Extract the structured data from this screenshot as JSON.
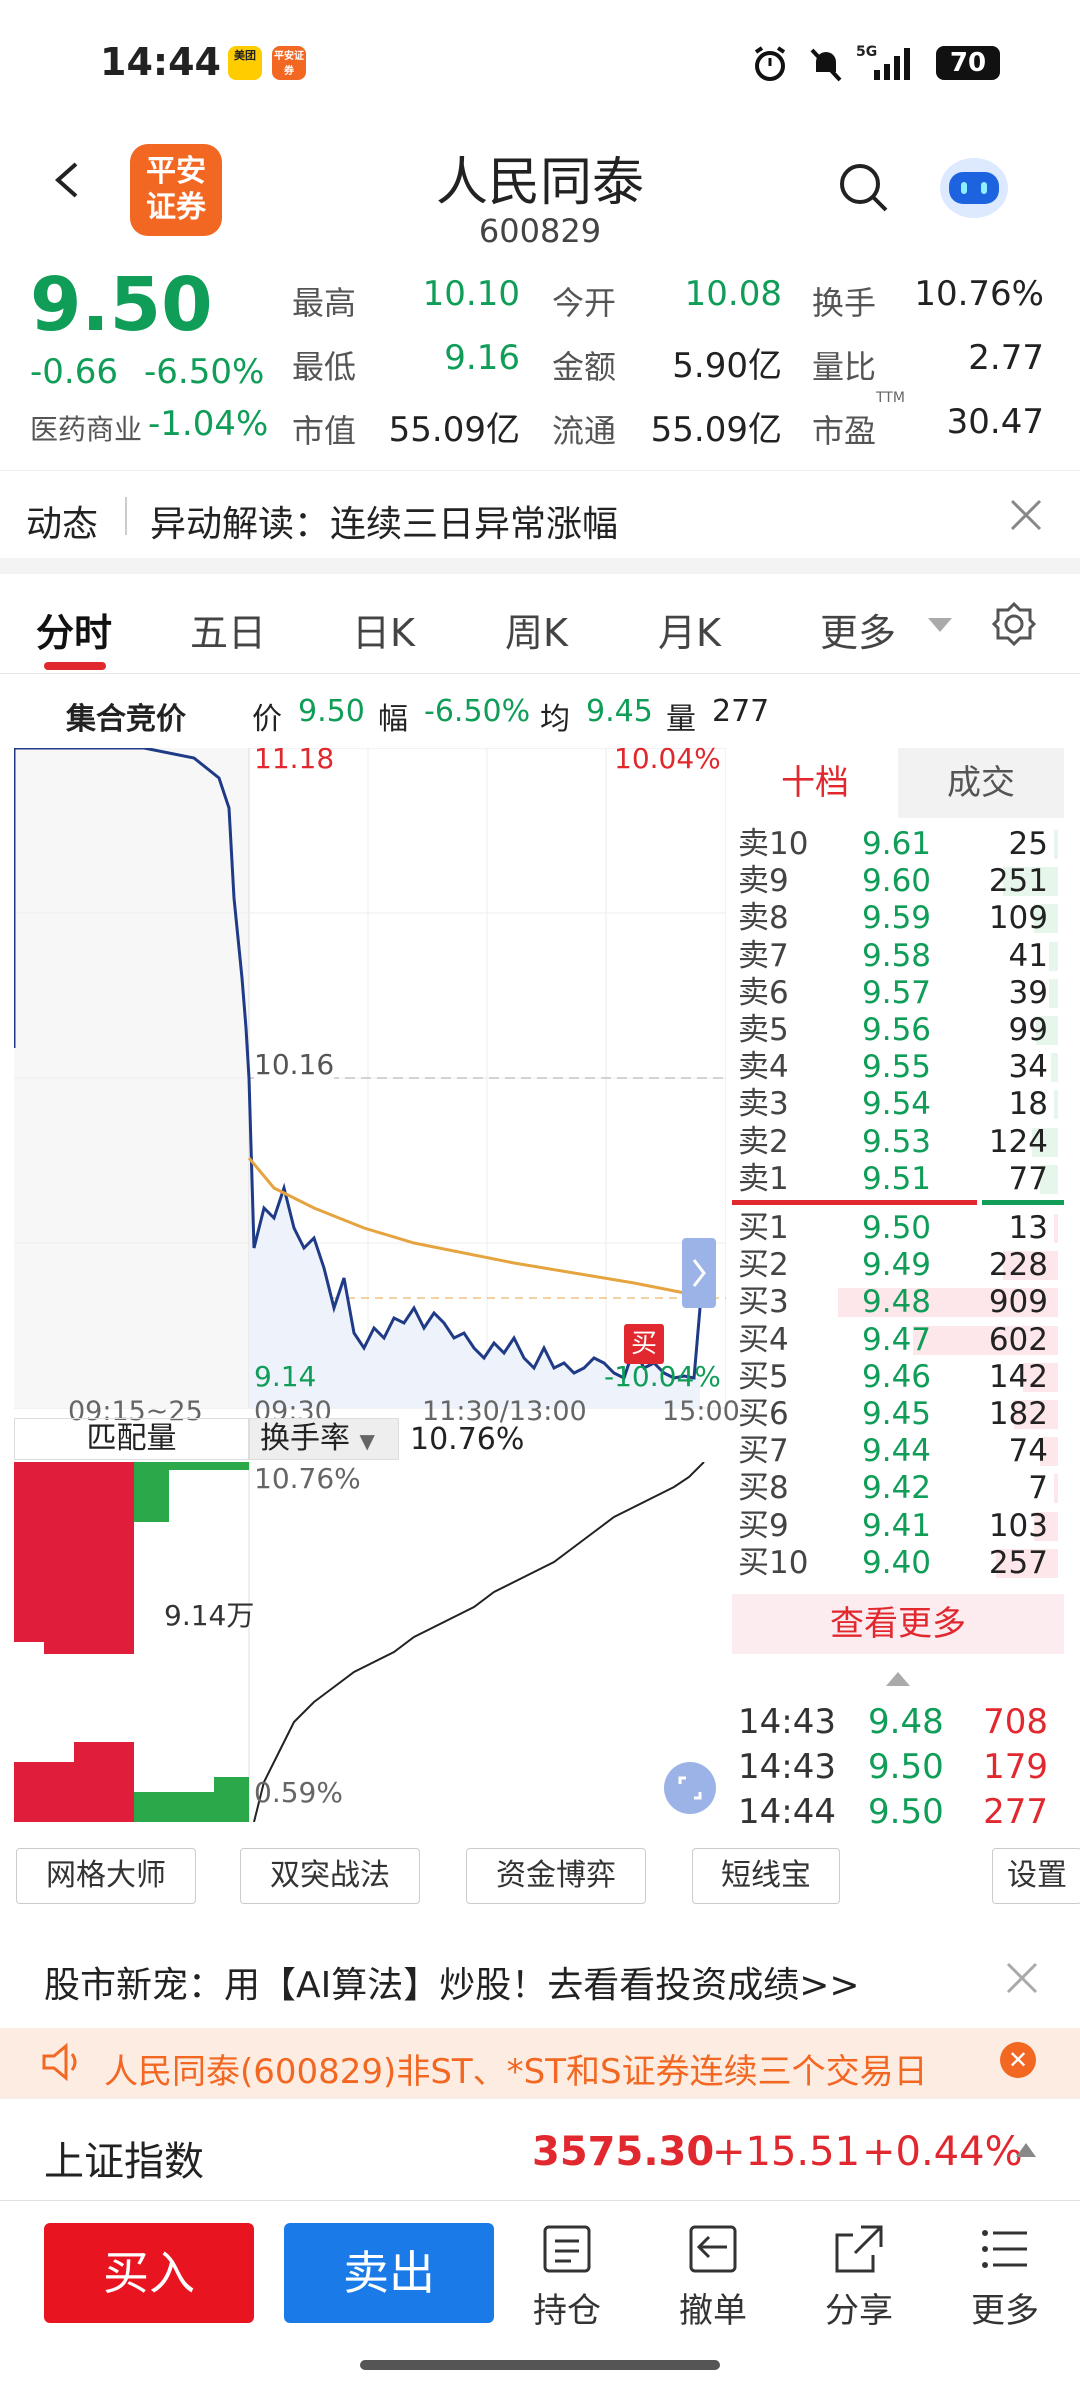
{
  "status_bar": {
    "time": "14:44",
    "app1": "美团",
    "app2": "平安证券",
    "signal": "5G",
    "battery": "70"
  },
  "header": {
    "logo_text": "平安证券",
    "title": "人民同泰",
    "code": "600829"
  },
  "quote": {
    "price": "9.50",
    "change": "-0.66",
    "change_pct": "-6.50%",
    "sector": "医药商业",
    "sector_pct": "-1.04%",
    "fields": [
      {
        "label": "最高",
        "value": "10.10",
        "color": "green"
      },
      {
        "label": "今开",
        "value": "10.08",
        "color": "green"
      },
      {
        "label": "换手",
        "value": "10.76%",
        "color": "black"
      },
      {
        "label": "最低",
        "value": "9.16",
        "color": "green"
      },
      {
        "label": "金额",
        "value": "5.90亿",
        "color": "black"
      },
      {
        "label": "量比",
        "value": "2.77",
        "color": "black"
      },
      {
        "label": "市值",
        "value": "55.09亿",
        "color": "black"
      },
      {
        "label": "流通",
        "value": "55.09亿",
        "color": "black"
      },
      {
        "label": "市盈",
        "value": "30.47",
        "color": "black"
      }
    ],
    "ttm": "TTM"
  },
  "news": {
    "tag": "动态",
    "text": "异动解读：连续三日异常涨幅"
  },
  "tabs": [
    "分时",
    "五日",
    "日K",
    "周K",
    "月K",
    "更多"
  ],
  "infobar": {
    "label": "集合竞价",
    "price_label": "价",
    "price": "9.50",
    "range_label": "幅",
    "range": "-6.50%",
    "avg_label": "均",
    "avg": "9.45",
    "vol_label": "量",
    "vol": "277"
  },
  "chart": {
    "high_price": "11.18",
    "high_pct": "10.04%",
    "mid_price": "10.16",
    "low_price": "9.14",
    "low_pct": "-10.04%",
    "time_labels": [
      "09:15~25",
      "09:30",
      "11:30/13:00",
      "15:00"
    ],
    "buy_marker": "买",
    "sub_tab1": "匹配量",
    "sub_tab2": "换手率",
    "sub_value": "10.76%",
    "sub_top": "10.76%",
    "sub_mid": "9.14万",
    "sub_bottom": "0.59%"
  },
  "orderbook": {
    "tab1": "十档",
    "tab2": "成交",
    "asks": [
      {
        "label": "卖10",
        "price": "9.61",
        "vol": "25",
        "bar": 0.02
      },
      {
        "label": "卖9",
        "price": "9.60",
        "vol": "251",
        "bar": 0.25
      },
      {
        "label": "卖8",
        "price": "9.59",
        "vol": "109",
        "bar": 0.11
      },
      {
        "label": "卖7",
        "price": "9.58",
        "vol": "41",
        "bar": 0.04
      },
      {
        "label": "卖6",
        "price": "9.57",
        "vol": "39",
        "bar": 0.04
      },
      {
        "label": "卖5",
        "price": "9.56",
        "vol": "99",
        "bar": 0.1
      },
      {
        "label": "卖4",
        "price": "9.55",
        "vol": "34",
        "bar": 0.03
      },
      {
        "label": "卖3",
        "price": "9.54",
        "vol": "18",
        "bar": 0.02
      },
      {
        "label": "卖2",
        "price": "9.53",
        "vol": "124",
        "bar": 0.12
      },
      {
        "label": "卖1",
        "price": "9.51",
        "vol": "77",
        "bar": 0.08
      }
    ],
    "bids": [
      {
        "label": "买1",
        "price": "9.50",
        "vol": "13",
        "bar": 0.01
      },
      {
        "label": "买2",
        "price": "9.49",
        "vol": "228",
        "bar": 0.25
      },
      {
        "label": "买3",
        "price": "9.48",
        "vol": "909",
        "bar": 1.0
      },
      {
        "label": "买4",
        "price": "9.47",
        "vol": "602",
        "bar": 0.66
      },
      {
        "label": "买5",
        "price": "9.46",
        "vol": "142",
        "bar": 0.16
      },
      {
        "label": "买6",
        "price": "9.45",
        "vol": "182",
        "bar": 0.2
      },
      {
        "label": "买7",
        "price": "9.44",
        "vol": "74",
        "bar": 0.08
      },
      {
        "label": "买8",
        "price": "9.42",
        "vol": "7",
        "bar": 0.01
      },
      {
        "label": "买9",
        "price": "9.41",
        "vol": "103",
        "bar": 0.11
      },
      {
        "label": "买10",
        "price": "9.40",
        "vol": "257",
        "bar": 0.28
      }
    ],
    "more": "查看更多",
    "trades": [
      {
        "time": "14:43",
        "price": "9.48",
        "vol": "708"
      },
      {
        "time": "14:43",
        "price": "9.50",
        "vol": "179"
      },
      {
        "time": "14:44",
        "price": "9.50",
        "vol": "277"
      }
    ]
  },
  "tools": [
    "网格大师",
    "双突战法",
    "资金博弈",
    "短线宝",
    "设置"
  ],
  "promo": "股市新宠：用【AI算法】炒股！去看看投资成绩>>",
  "alert": "人民同泰(600829)非ST、*ST和S证券连续三个交易日",
  "index": {
    "name": "上证指数",
    "value": "3575.30",
    "change": "+15.51",
    "pct": "+0.44%"
  },
  "actions": {
    "buy": "买入",
    "sell": "卖出",
    "items": [
      "持仓",
      "撤单",
      "分享",
      "更多"
    ]
  }
}
